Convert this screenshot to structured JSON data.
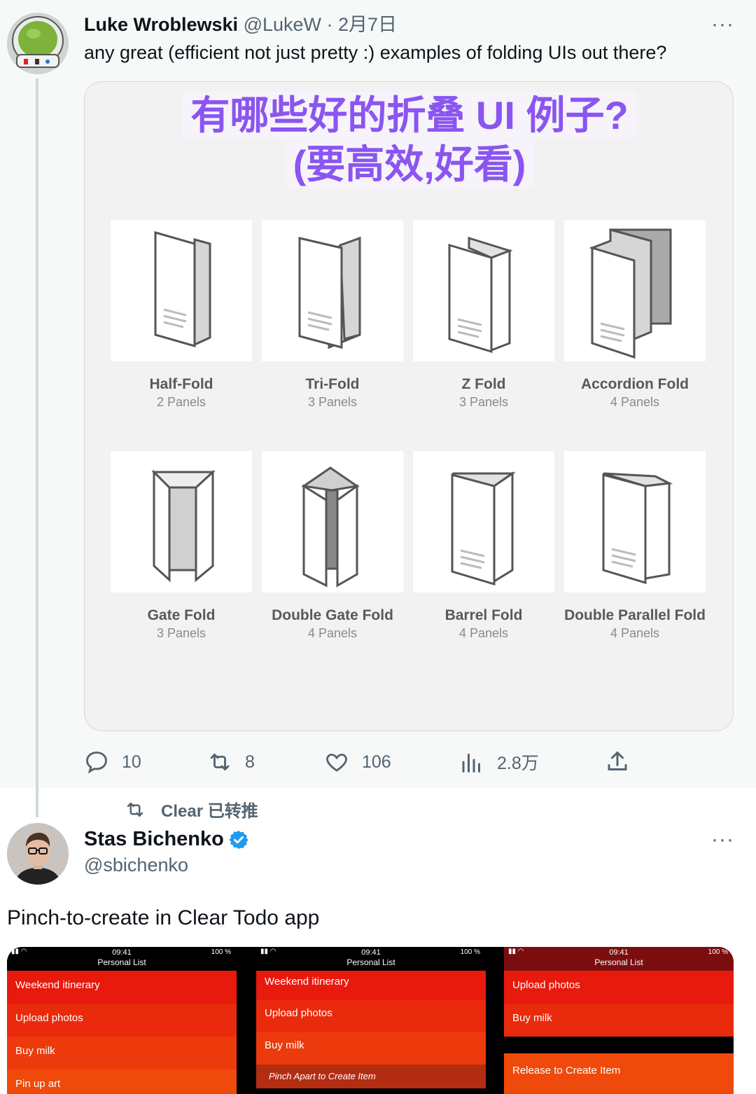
{
  "tweet1": {
    "author_name": "Luke Wroblewski",
    "author_meta": "@LukeW · 2月7日",
    "text": "any great (efficient not just pretty :) examples of folding UIs out there?",
    "more": "···",
    "overlay_line1": "有哪些好的折叠 UI 例子?",
    "overlay_line2": "(要高效,好看)",
    "folds": [
      {
        "name": "Half-Fold",
        "panels": "2 Panels"
      },
      {
        "name": "Tri-Fold",
        "panels": "3 Panels"
      },
      {
        "name": "Z Fold",
        "panels": "3 Panels"
      },
      {
        "name": "Accordion Fold",
        "panels": "4 Panels"
      },
      {
        "name": "Gate Fold",
        "panels": "3 Panels"
      },
      {
        "name": "Double Gate Fold",
        "panels": "4 Panels"
      },
      {
        "name": "Barrel Fold",
        "panels": "4 Panels"
      },
      {
        "name": "Double Parallel Fold",
        "panels": "4 Panels"
      }
    ],
    "actions": {
      "replies": "10",
      "retweets": "8",
      "likes": "106",
      "views": "2.8万"
    }
  },
  "retweet_label": "Clear 已转推",
  "tweet2": {
    "author_name": "Stas Bichenko",
    "handle": "@sbichenko",
    "more": "···",
    "text": "Pinch-to-create in Clear Todo app",
    "phones": [
      {
        "time": "09:41",
        "battery": "100 %",
        "title": "Personal List",
        "items": [
          "Weekend itinerary",
          "Upload photos",
          "Buy milk",
          "Pin up art"
        ]
      },
      {
        "time": "09:41",
        "battery": "100 %",
        "title": "Personal List",
        "items": [
          "Weekend itinerary",
          "Upload photos",
          "Buy milk"
        ],
        "hint": "Pinch Apart to Create Item"
      },
      {
        "time": "09:41",
        "battery": "100 %",
        "title": "Personal List",
        "items": [
          "Upload photos",
          "Buy milk"
        ],
        "hint": "Release to Create Item"
      }
    ]
  },
  "colors": {
    "accent_purple": "#8a55f0",
    "verified_blue": "#1d9bf0",
    "clear_red": "#e8190d",
    "clear_orange": "#ef4a0b"
  }
}
